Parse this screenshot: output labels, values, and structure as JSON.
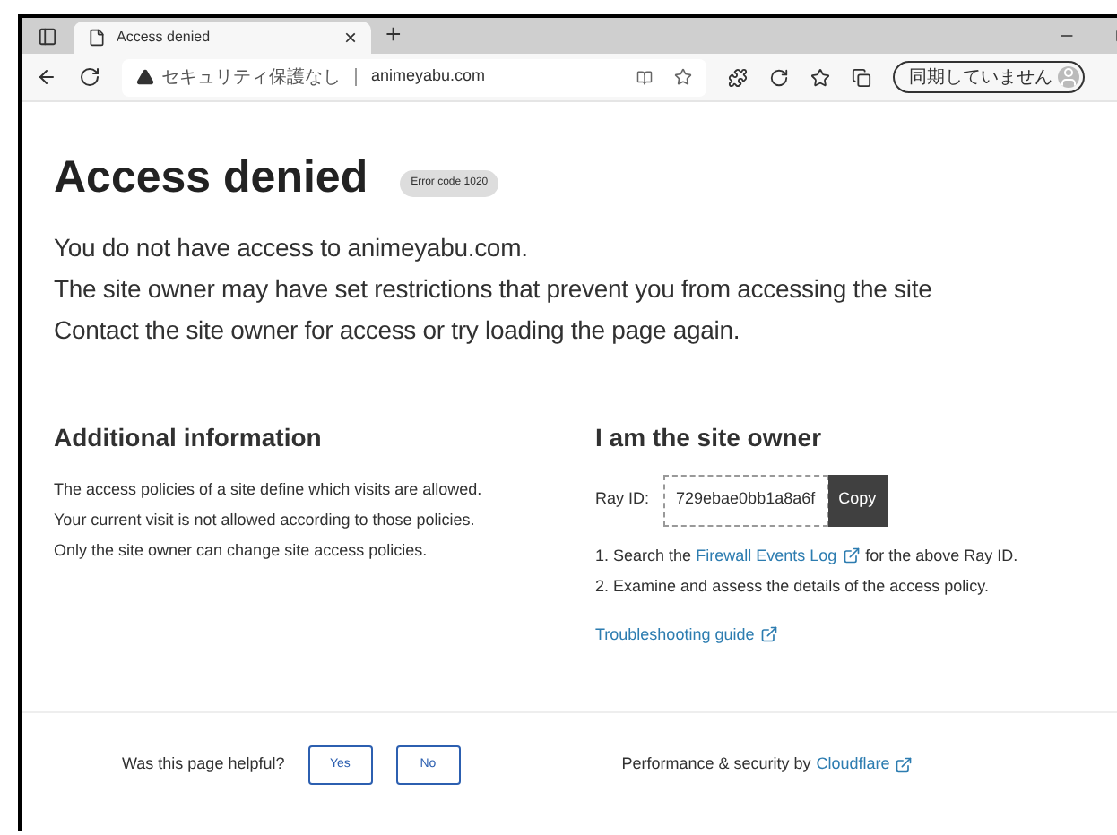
{
  "browser": {
    "tab": {
      "title": "Access denied",
      "selected": true
    },
    "close_tab": "×",
    "new_tab": "+",
    "security_label": "セキュリティ保護なし",
    "url": "animeyabu.com",
    "profile_label": "同期していません"
  },
  "page": {
    "title": "Access denied",
    "error_badge": "Error code 1020",
    "messages": [
      "You do not have access to animeyabu.com.",
      "The site owner may have set restrictions that prevent you from accessing the site",
      "Contact the site owner for access or try loading the page again."
    ],
    "additional": {
      "heading": "Additional information",
      "paragraphs": [
        "The access policies of a site define which visits are allowed. Your current visit is not allowed according to those policies.",
        "Only the site owner can change site access policies."
      ]
    },
    "owner": {
      "heading": "I am the site owner",
      "ray_label": "Ray ID:",
      "ray_id": "729ebae0bb1a8a6f",
      "copy_button": "Copy",
      "steps": [
        {
          "number": "1.",
          "before": "Search the",
          "link": "Firewall Events Log",
          "after": "for the above Ray ID."
        },
        {
          "number": "2.",
          "before": "Examine and assess the details of the access policy."
        }
      ],
      "troubleshooting_link": "Troubleshooting guide"
    },
    "footer": {
      "question": "Was this page helpful?",
      "buttons": [
        "Yes",
        "No"
      ],
      "credit": "Performance & security by",
      "credit_link": "Cloudflare"
    }
  }
}
